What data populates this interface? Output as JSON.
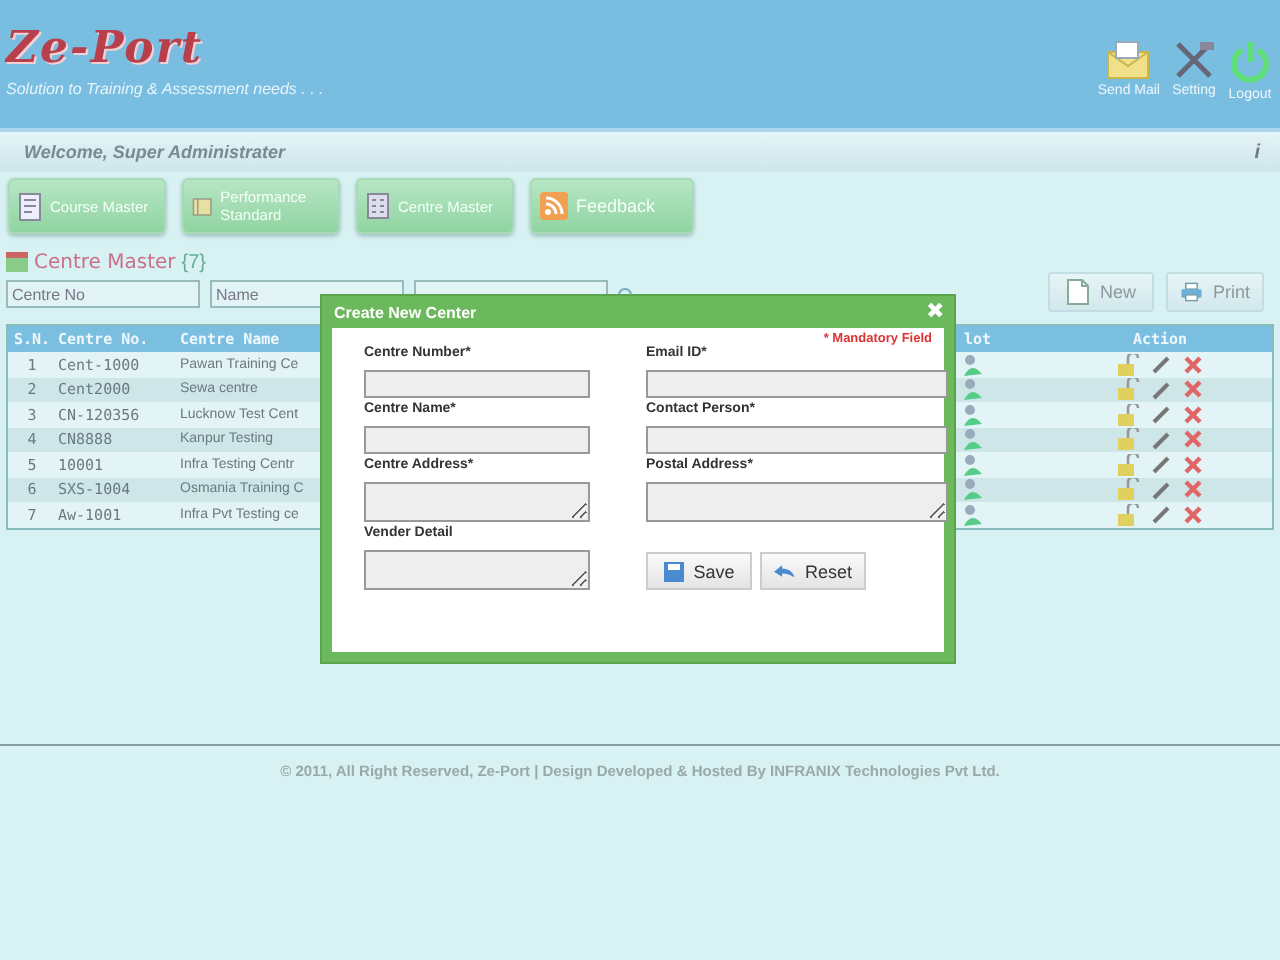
{
  "header": {
    "logo": "Ze-Port",
    "tagline": "Solution to Training & Assessment needs . . .",
    "actions": [
      {
        "kind": "mail",
        "label": "Send Mail"
      },
      {
        "kind": "setting",
        "label": "Setting"
      },
      {
        "kind": "logout",
        "label": "Logout"
      }
    ]
  },
  "welcome": "Welcome, Super Administrater",
  "info_icon": "i",
  "nav": [
    {
      "kind": "course",
      "label": "Course Master"
    },
    {
      "kind": "performance",
      "label": "Performance Standard"
    },
    {
      "kind": "centre",
      "label": "Centre Master"
    },
    {
      "kind": "feedback",
      "label": "Feedback"
    }
  ],
  "section": {
    "title": "Centre Master",
    "count": "{7}"
  },
  "filters": [
    {
      "kind": "text",
      "placeholder": "Centre No"
    },
    {
      "kind": "text",
      "placeholder": "Name"
    },
    {
      "kind": "covered"
    }
  ],
  "toolbar": [
    {
      "kind": "new",
      "label": "New"
    },
    {
      "kind": "print",
      "label": "Print"
    }
  ],
  "table": {
    "columns": [
      "S.N.",
      "Centre No.",
      "Centre Name",
      "lot",
      "Action"
    ],
    "rows": [
      {
        "sn": "1",
        "no": "Cent-1000",
        "name": "Pawan Training Ce"
      },
      {
        "sn": "2",
        "no": "Cent2000",
        "name": "Sewa centre"
      },
      {
        "sn": "3",
        "no": "CN-120356",
        "name": "Lucknow Test Cent"
      },
      {
        "sn": "4",
        "no": "CN8888",
        "name": "Kanpur Testing"
      },
      {
        "sn": "5",
        "no": "10001",
        "name": "Infra Testing Centr"
      },
      {
        "sn": "6",
        "no": "SXS-1004",
        "name": "Osmania Training C"
      },
      {
        "sn": "7",
        "no": "Aw-1001",
        "name": "Infra Pvt Testing ce"
      }
    ]
  },
  "footer": "© 2011, All Right Reserved, Ze-Port | Design Developed & Hosted By INFRANIX Technologies Pvt Ltd.",
  "dialog": {
    "title": "Create New Center",
    "close": "✖",
    "note": "* Mandatory Field",
    "fields": [
      {
        "label": "Centre Number*",
        "kind": "input"
      },
      {
        "label": "Email ID*",
        "kind": "input"
      },
      {
        "label": "Centre Name*",
        "kind": "input"
      },
      {
        "label": "Contact Person*",
        "kind": "input"
      },
      {
        "label": "Centre Address*",
        "kind": "textarea"
      },
      {
        "label": "Postal Address*",
        "kind": "textarea"
      },
      {
        "label": "Vender Detail",
        "kind": "textarea"
      }
    ],
    "buttons": [
      {
        "kind": "save",
        "label": "Save"
      },
      {
        "kind": "reset",
        "label": "Reset"
      }
    ]
  }
}
